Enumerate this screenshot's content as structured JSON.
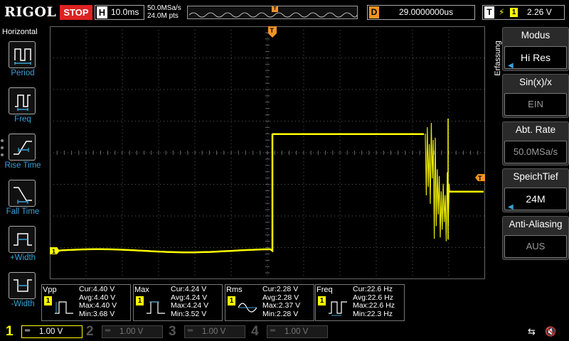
{
  "topbar": {
    "brand": "RIGOL",
    "run_state": "STOP",
    "horizontal_label": "H",
    "timebase": "10.0ms",
    "sample_rate": "50.0MSa/s",
    "memory_points": "24.0M pts",
    "delay_label": "D",
    "delay_value": "29.0000000us",
    "trigger_label": "T",
    "trigger_source": "1",
    "trigger_level": "2.26 V",
    "trigger_marker": "T"
  },
  "left_menu": {
    "title": "Horizontal",
    "items": [
      {
        "label": "Period",
        "icon": "period-icon"
      },
      {
        "label": "Freq",
        "icon": "frequency-icon"
      },
      {
        "label": "Rise Time",
        "icon": "rise-time-icon"
      },
      {
        "label": "Fall Time",
        "icon": "fall-time-icon"
      },
      {
        "label": "+Width",
        "icon": "positive-width-icon"
      },
      {
        "label": "-Width",
        "icon": "negative-width-icon"
      }
    ]
  },
  "right_menu": {
    "title": "Erfassung",
    "blocks": [
      {
        "label": "Modus",
        "value": "Hi Res",
        "enabled": true
      },
      {
        "label": "Sin(x)/x",
        "value": "EIN",
        "enabled": false
      },
      {
        "label": "Abt. Rate",
        "value": "50.0MSa/s",
        "enabled": false
      },
      {
        "label": "SpeichTief",
        "value": "24M",
        "enabled": true
      },
      {
        "label": "Anti-Aliasing",
        "value": "AUS",
        "enabled": false
      }
    ]
  },
  "measurements": [
    {
      "name": "Vpp",
      "channel": "1",
      "icon": "vpp-icon",
      "rows": [
        "Cur:4.40 V",
        "Avg:4.40 V",
        "Max:4.40 V",
        "Min:3.68 V"
      ]
    },
    {
      "name": "Max",
      "channel": "1",
      "icon": "max-icon",
      "rows": [
        "Cur:4.24 V",
        "Avg:4.24 V",
        "Max:4.24 V",
        "Min:3.52 V"
      ]
    },
    {
      "name": "Rms",
      "channel": "1",
      "icon": "rms-icon",
      "rows": [
        "Cur:2.28 V",
        "Avg:2.28 V",
        "Max:2.37 V",
        "Min:2.28 V"
      ]
    },
    {
      "name": "Freq",
      "channel": "1",
      "icon": "freq-icon",
      "rows": [
        "Cur:22.6 Hz",
        "Avg:22.6 Hz",
        "Max:22.6 Hz",
        "Min:22.3 Hz"
      ]
    }
  ],
  "channels": [
    {
      "number": "1",
      "scale": "1.00 V",
      "active": true
    },
    {
      "number": "2",
      "scale": "1.00 V",
      "active": false
    },
    {
      "number": "3",
      "scale": "1.00 V",
      "active": false
    },
    {
      "number": "4",
      "scale": "1.00 V",
      "active": false
    }
  ],
  "waveform": {
    "channel_marker": "1",
    "color": "#ffff00",
    "trigger_color": "#f29422"
  },
  "colors": {
    "accent_blue": "#3aa2d8",
    "stop_red": "#d22222",
    "trace_yellow": "#ffff00",
    "trigger_orange": "#f29422"
  }
}
